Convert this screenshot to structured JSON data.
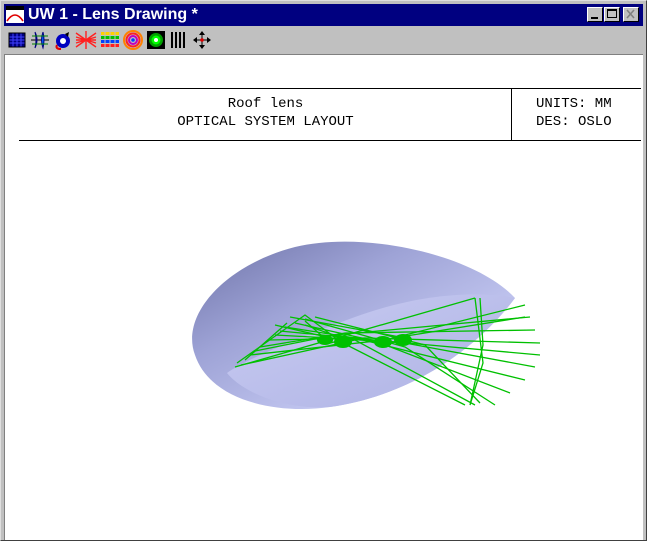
{
  "window": {
    "title": "UW 1 - Lens Drawing *",
    "controls": [
      "minimize",
      "maximize",
      "close"
    ]
  },
  "toolbar": {
    "tools": [
      {
        "name": "grid-icon"
      },
      {
        "name": "lens-layout-icon"
      },
      {
        "name": "rotate-icon"
      },
      {
        "name": "ray-fan-icon"
      },
      {
        "name": "spot-bands-icon"
      },
      {
        "name": "concentric-rings-icon"
      },
      {
        "name": "target-icon"
      },
      {
        "name": "vertical-bars-icon"
      },
      {
        "name": "move-arrows-icon"
      }
    ]
  },
  "drawing": {
    "lens_name": "Roof lens",
    "layout_title": "OPTICAL SYSTEM LAYOUT",
    "units": "UNITS: MM",
    "designer": "DES: OSLO",
    "colors": {
      "lens": "#b9bde6",
      "rays": "#00c000",
      "frame": "#000000"
    }
  }
}
